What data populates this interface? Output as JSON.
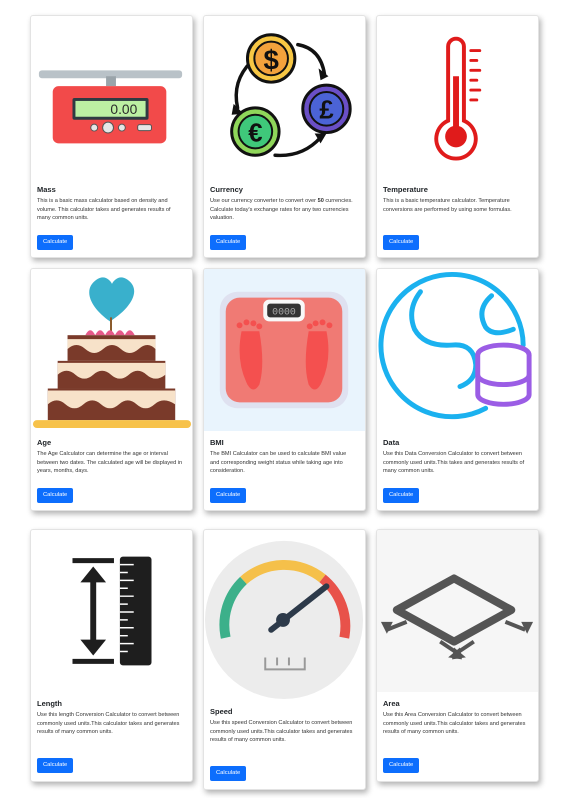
{
  "cards": [
    {
      "title": "Mass",
      "desc": "This is a basic mass calculator based on density and volume. This calculator takes and generates results of many common units.",
      "button": "Calculate",
      "scale_display": "0.00"
    },
    {
      "title": "Currency",
      "desc_before": "Use our currency converter to convert over ",
      "desc_bold": "50",
      "desc_after": " currencies. Calculate today's exchange rates for any two currencies valuation.",
      "button": "Calculate"
    },
    {
      "title": "Temperature",
      "desc": "This is a basic temperature calculator. Temperature conversions are performed by using some formulas.",
      "button": "Calculate"
    },
    {
      "title": "Age",
      "desc": "The Age Calculator can determine the age or interval between two dates. The calculated age will be displayed in years, months, days.",
      "button": "Calculate"
    },
    {
      "title": "BMI",
      "desc": "The BMI Calculator can be used to calculate BMI value and corresponding weight status while taking age into consideration.",
      "button": "Calculate",
      "scale_display": "0000"
    },
    {
      "title": "Data",
      "desc": "Use this Data Conversion Calculator to convert between commonly used units.This takes and generates results of many common units.",
      "button": "Calculate"
    },
    {
      "title": "Length",
      "desc": "Use this length Conversion Calculator to convert between commonly used units.This calculator takes and generates results of many common units.",
      "button": "Calculate"
    },
    {
      "title": "Speed",
      "desc": "Use this speed Conversion Calculator to convert between commonly used units.This calculator takes and generates results of many common units.",
      "button": "Calculate"
    },
    {
      "title": "Area",
      "desc": "Use this Area Conversion Calculator to convert between commonly used units.This calculator takes and generates results of many common units.",
      "button": "Calculate"
    }
  ],
  "icons": {
    "mass": "scale-icon",
    "currency": "currency-exchange-icon",
    "temperature": "thermometer-icon",
    "age": "cake-icon",
    "bmi": "bathroom-scale-icon",
    "data": "data-globe-icon",
    "length": "ruler-icon",
    "speed": "speedometer-icon",
    "area": "area-arrows-icon"
  },
  "colors": {
    "button": "#0d6efd",
    "button_text": "#ffffff"
  }
}
